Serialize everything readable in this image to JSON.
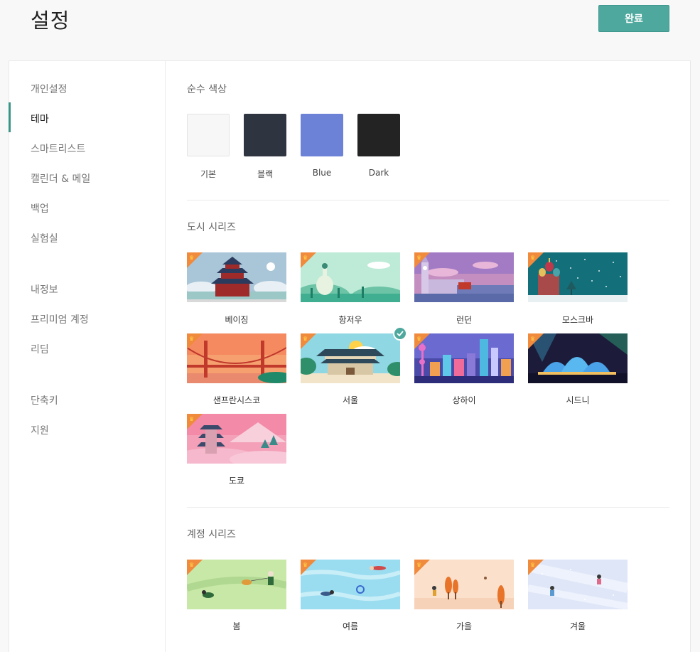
{
  "header": {
    "title": "설정",
    "done_label": "완료"
  },
  "sidebar": {
    "items": [
      {
        "label": "개인설정"
      },
      {
        "label": "테마"
      },
      {
        "label": "스마트리스트"
      },
      {
        "label": "캘린더 & 메일"
      },
      {
        "label": "백업"
      },
      {
        "label": "실험실"
      },
      {
        "label": "내정보"
      },
      {
        "label": "프리미엄 계정"
      },
      {
        "label": "리딤"
      },
      {
        "label": "단축키"
      },
      {
        "label": "지원"
      }
    ],
    "active": "테마"
  },
  "themes": {
    "pure_color": {
      "title": "순수 색상",
      "items": [
        {
          "label": "기본",
          "color": "#f7f7f7"
        },
        {
          "label": "블랙",
          "color": "#2e3440"
        },
        {
          "label": "Blue",
          "color": "#6b82d6"
        },
        {
          "label": "Dark",
          "color": "#232323"
        }
      ]
    },
    "city": {
      "title": "도시 시리즈",
      "items": [
        {
          "label": "베이징",
          "icon": "beijing-temple-image"
        },
        {
          "label": "항저우",
          "icon": "hangzhou-pagoda-image"
        },
        {
          "label": "런던",
          "icon": "london-bigben-image"
        },
        {
          "label": "모스크바",
          "icon": "moscow-cathedral-image"
        },
        {
          "label": "샌프란시스코",
          "icon": "golden-gate-image"
        },
        {
          "label": "서울",
          "icon": "seoul-gate-image",
          "selected": true
        },
        {
          "label": "상하이",
          "icon": "shanghai-skyline-image"
        },
        {
          "label": "시드니",
          "icon": "sydney-opera-image"
        },
        {
          "label": "도쿄",
          "icon": "tokyo-pagoda-image"
        }
      ]
    },
    "season": {
      "title": "계정 시리즈",
      "items": [
        {
          "label": "봄",
          "icon": "spring-scene-image"
        },
        {
          "label": "여름",
          "icon": "summer-scene-image"
        },
        {
          "label": "가을",
          "icon": "autumn-scene-image"
        },
        {
          "label": "겨울",
          "icon": "winter-scene-image"
        }
      ]
    }
  },
  "colors": {
    "accent": "#4ea89e",
    "premium_badge": "#f08a3c"
  }
}
